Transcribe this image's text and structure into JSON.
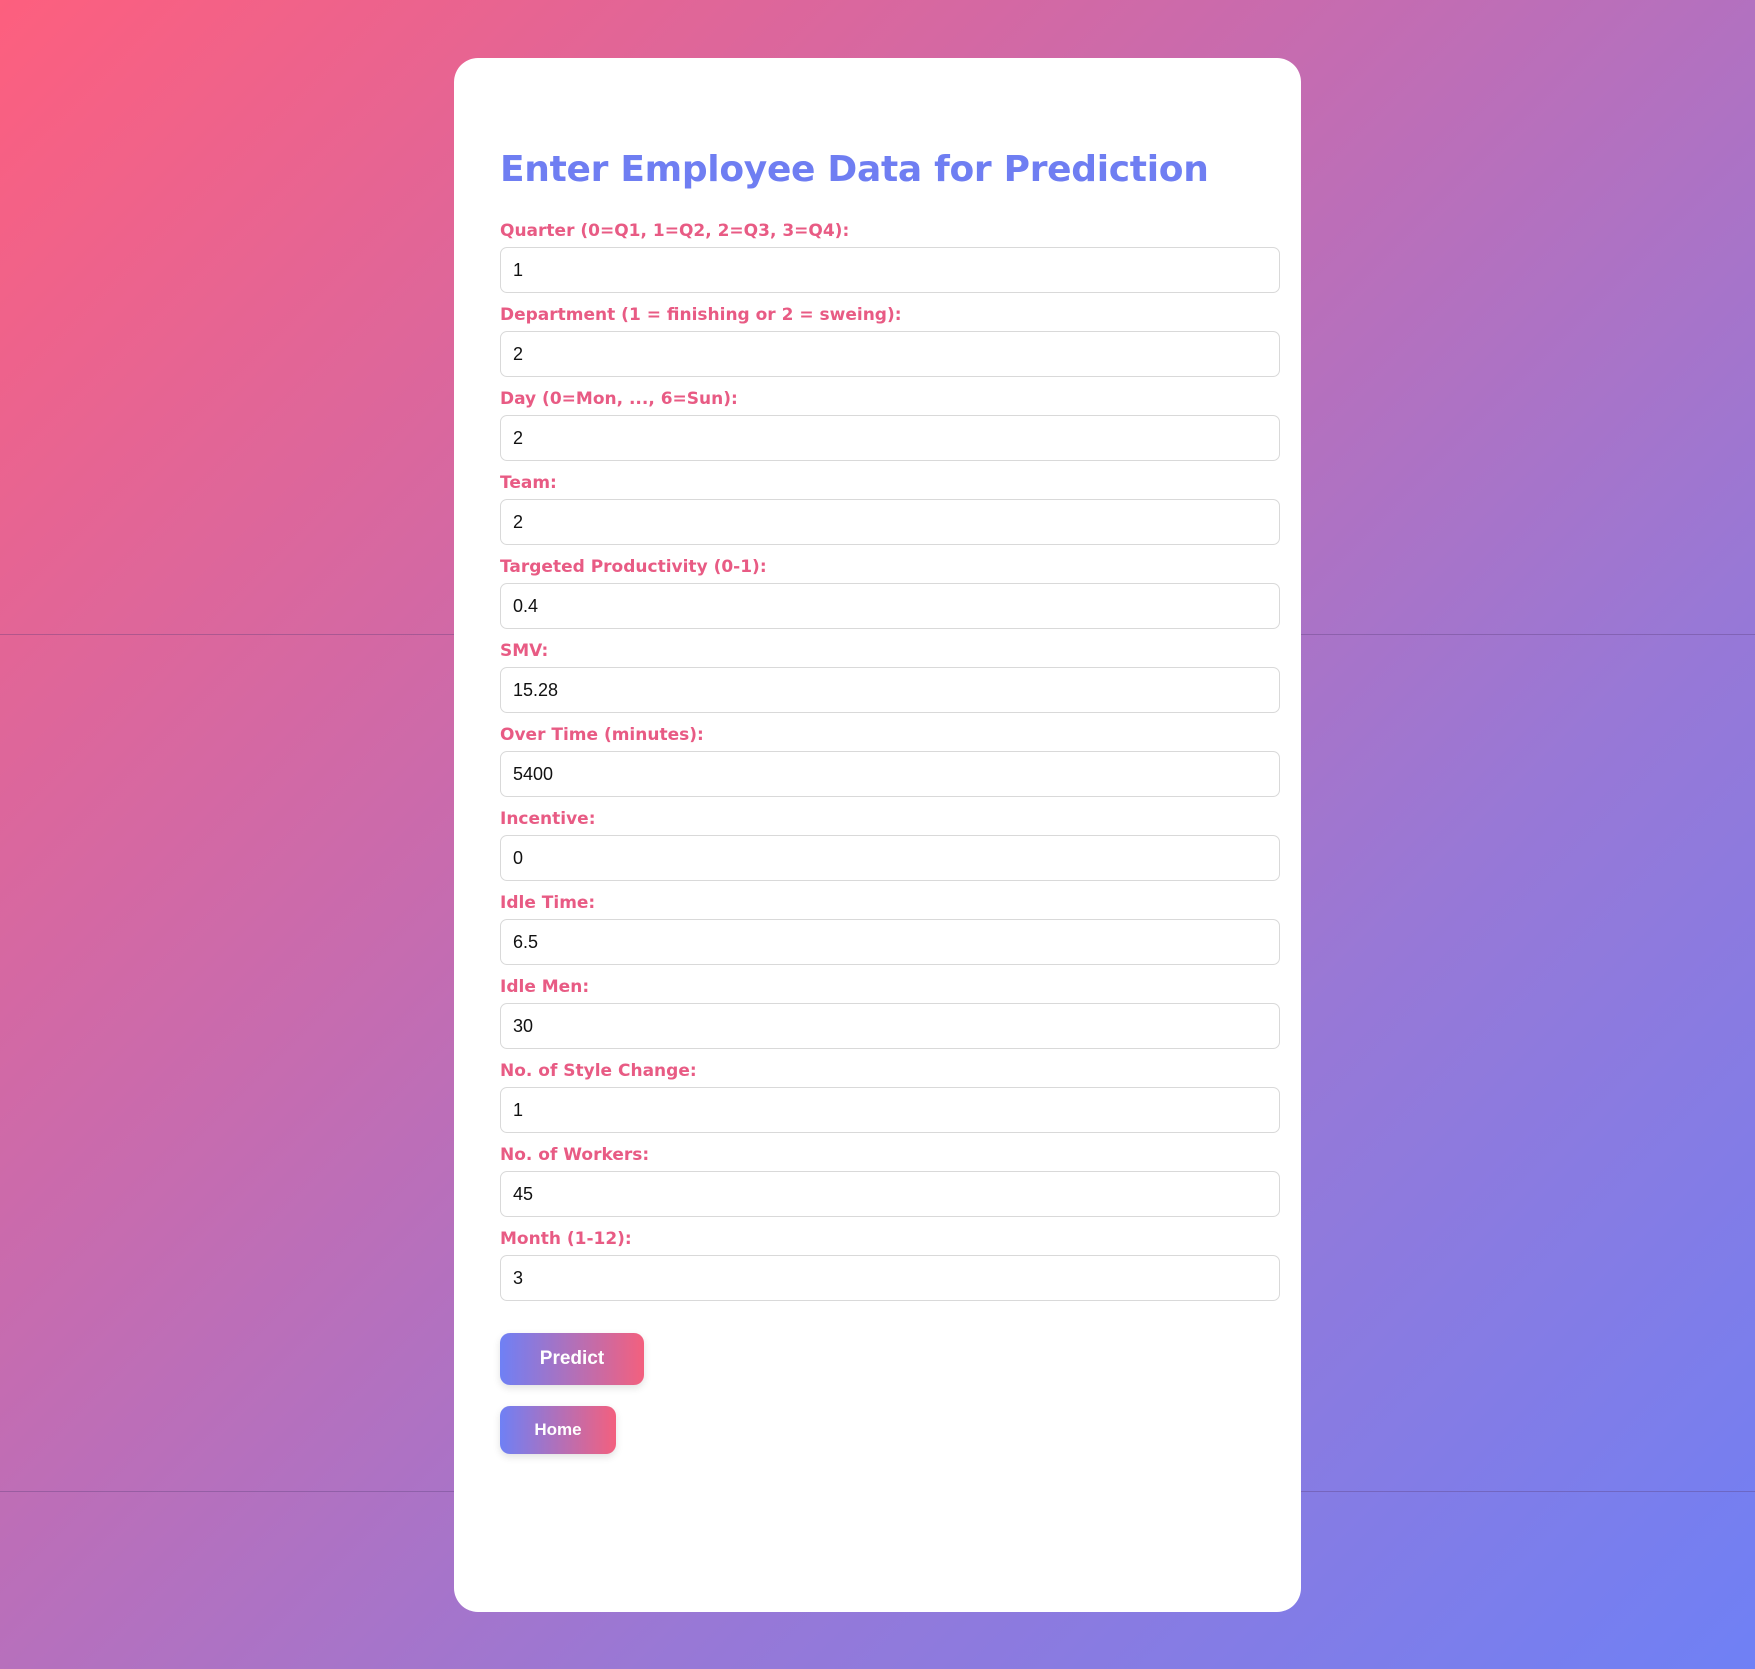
{
  "form": {
    "title": "Enter Employee Data for Prediction",
    "fields": [
      {
        "label": "Quarter (0=Q1, 1=Q2, 2=Q3, 3=Q4):",
        "value": "1"
      },
      {
        "label": "Department (1 = finishing or 2 = sweing):",
        "value": "2"
      },
      {
        "label": "Day (0=Mon, ..., 6=Sun):",
        "value": "2"
      },
      {
        "label": "Team:",
        "value": "2"
      },
      {
        "label": "Targeted Productivity (0-1):",
        "value": "0.4"
      },
      {
        "label": "SMV:",
        "value": "15.28"
      },
      {
        "label": "Over Time (minutes):",
        "value": "5400"
      },
      {
        "label": "Incentive:",
        "value": "0"
      },
      {
        "label": "Idle Time:",
        "value": "6.5"
      },
      {
        "label": "Idle Men:",
        "value": "30"
      },
      {
        "label": "No. of Style Change:",
        "value": "1"
      },
      {
        "label": "No. of Workers:",
        "value": "45"
      },
      {
        "label": "Month (1-12):",
        "value": "3"
      }
    ],
    "predict_label": "Predict",
    "home_label": "Home"
  },
  "colors": {
    "accent_blue": "#6f7ef2",
    "label_pink": "#e85b84",
    "gradient_start": "#fd5f7e",
    "gradient_end": "#6f80f5"
  }
}
